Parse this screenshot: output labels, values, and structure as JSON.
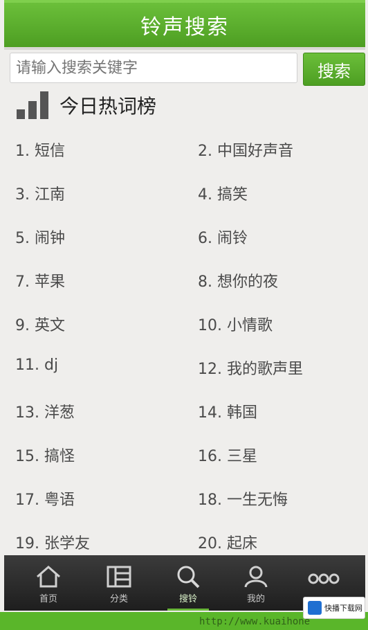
{
  "header": {
    "title": "铃声搜索"
  },
  "search": {
    "placeholder": "请输入搜索关键字",
    "button_label": "搜索"
  },
  "hot": {
    "title": "今日热词榜",
    "items": [
      "1. 短信",
      "2. 中国好声音",
      "3. 江南",
      "4. 搞笑",
      "5. 闹钟",
      "6. 闹铃",
      "7. 苹果",
      "8. 想你的夜",
      "9. 英文",
      "10. 小情歌",
      "11. dj",
      "12. 我的歌声里",
      "13. 洋葱",
      "14. 韩国",
      "15. 搞怪",
      "16. 三星",
      "17. 粤语",
      "18. 一生无悔",
      "19. 张学友",
      "20. 起床"
    ]
  },
  "tabs": [
    {
      "label": "首页",
      "icon": "home-icon"
    },
    {
      "label": "分类",
      "icon": "list-icon"
    },
    {
      "label": "搜铃",
      "icon": "search-icon",
      "active": true
    },
    {
      "label": "我的",
      "icon": "user-icon"
    },
    {
      "label": "",
      "icon": "more-icon"
    }
  ],
  "footer": {
    "url": "http://www.kuaihone",
    "badge": "快播下载网"
  },
  "colors": {
    "accent": "#5aab2c",
    "tabbar": "#2a2a2a",
    "background": "#efeeec"
  }
}
